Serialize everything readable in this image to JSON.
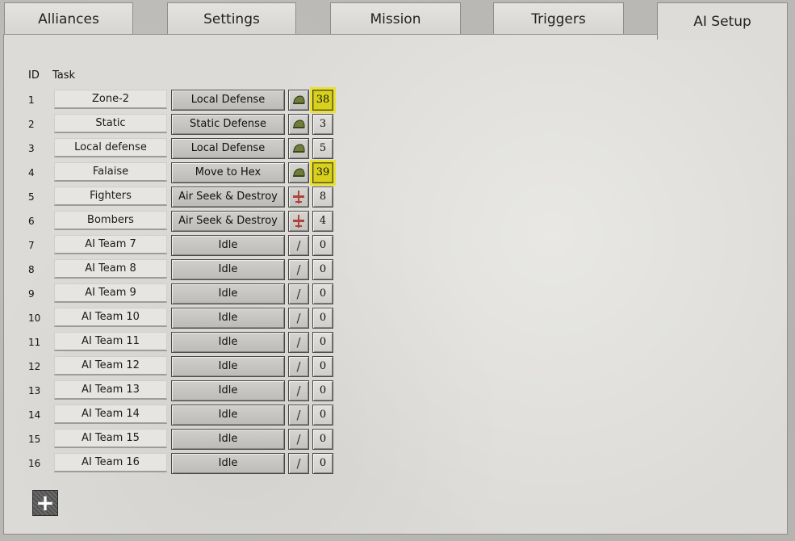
{
  "tabs": [
    {
      "label": "Alliances",
      "active": false
    },
    {
      "label": "Settings",
      "active": false
    },
    {
      "label": "Mission",
      "active": false
    },
    {
      "label": "Triggers",
      "active": false
    },
    {
      "label": "AI Setup",
      "active": true
    }
  ],
  "table": {
    "headers": {
      "id": "ID",
      "task": "Task"
    },
    "rows": [
      {
        "id": "1",
        "name": "Zone-2",
        "task": "Local Defense",
        "unit_icon": "helmet-icon",
        "count": "38",
        "highlight": true
      },
      {
        "id": "2",
        "name": "Static",
        "task": "Static Defense",
        "unit_icon": "helmet-icon",
        "count": "3",
        "highlight": false
      },
      {
        "id": "3",
        "name": "Local defense",
        "task": "Local Defense",
        "unit_icon": "helmet-icon",
        "count": "5",
        "highlight": false
      },
      {
        "id": "4",
        "name": "Falaise",
        "task": "Move to Hex",
        "unit_icon": "helmet-icon",
        "count": "39",
        "highlight": true
      },
      {
        "id": "5",
        "name": "Fighters",
        "task": "Air Seek & Destroy",
        "unit_icon": "plane-icon",
        "count": "8",
        "highlight": false
      },
      {
        "id": "6",
        "name": "Bombers",
        "task": "Air Seek & Destroy",
        "unit_icon": "plane-icon",
        "count": "4",
        "highlight": false
      },
      {
        "id": "7",
        "name": "AI Team 7",
        "task": "Idle",
        "unit_icon": "slash-icon",
        "count": "0",
        "highlight": false
      },
      {
        "id": "8",
        "name": "AI Team 8",
        "task": "Idle",
        "unit_icon": "slash-icon",
        "count": "0",
        "highlight": false
      },
      {
        "id": "9",
        "name": "AI Team 9",
        "task": "Idle",
        "unit_icon": "slash-icon",
        "count": "0",
        "highlight": false
      },
      {
        "id": "10",
        "name": "AI Team 10",
        "task": "Idle",
        "unit_icon": "slash-icon",
        "count": "0",
        "highlight": false
      },
      {
        "id": "11",
        "name": "AI Team 11",
        "task": "Idle",
        "unit_icon": "slash-icon",
        "count": "0",
        "highlight": false
      },
      {
        "id": "12",
        "name": "AI Team 12",
        "task": "Idle",
        "unit_icon": "slash-icon",
        "count": "0",
        "highlight": false
      },
      {
        "id": "13",
        "name": "AI Team 13",
        "task": "Idle",
        "unit_icon": "slash-icon",
        "count": "0",
        "highlight": false
      },
      {
        "id": "14",
        "name": "AI Team 14",
        "task": "Idle",
        "unit_icon": "slash-icon",
        "count": "0",
        "highlight": false
      },
      {
        "id": "15",
        "name": "AI Team 15",
        "task": "Idle",
        "unit_icon": "slash-icon",
        "count": "0",
        "highlight": false
      },
      {
        "id": "16",
        "name": "AI Team 16",
        "task": "Idle",
        "unit_icon": "slash-icon",
        "count": "0",
        "highlight": false
      }
    ]
  },
  "add_button": {
    "icon": "plus-icon"
  },
  "colors": {
    "highlight": "#d8d01c",
    "helmet": "#6f7d3a",
    "plane": "#b0423a"
  }
}
